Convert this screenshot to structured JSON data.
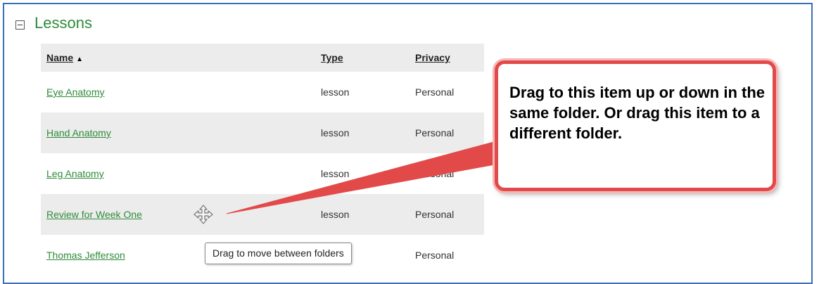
{
  "section": {
    "title": "Lessons"
  },
  "table": {
    "headers": {
      "name": "Name",
      "type": "Type",
      "privacy": "Privacy",
      "sort_indicator": "▲"
    },
    "rows": [
      {
        "name": "Eye Anatomy",
        "type": "lesson",
        "privacy": "Personal"
      },
      {
        "name": "Hand Anatomy",
        "type": "lesson",
        "privacy": "Personal"
      },
      {
        "name": "Leg Anatomy",
        "type": "lesson",
        "privacy": "Personal"
      },
      {
        "name": "Review for Week One",
        "type": "lesson",
        "privacy": "Personal"
      },
      {
        "name": "Thomas Jefferson",
        "type": "",
        "privacy": "Personal"
      }
    ]
  },
  "tooltip": {
    "text": "Drag to move between folders"
  },
  "callout": {
    "text": "Drag to this item up or down in the same folder. Or drag this item to a different folder."
  },
  "icons": {
    "collapse": "collapse-minus-icon",
    "move": "move-arrows-icon"
  },
  "colors": {
    "link": "#2e8b3a",
    "callout_border": "#e24a4a",
    "frame_border": "#3d6fb3",
    "row_shade": "#ececec"
  }
}
